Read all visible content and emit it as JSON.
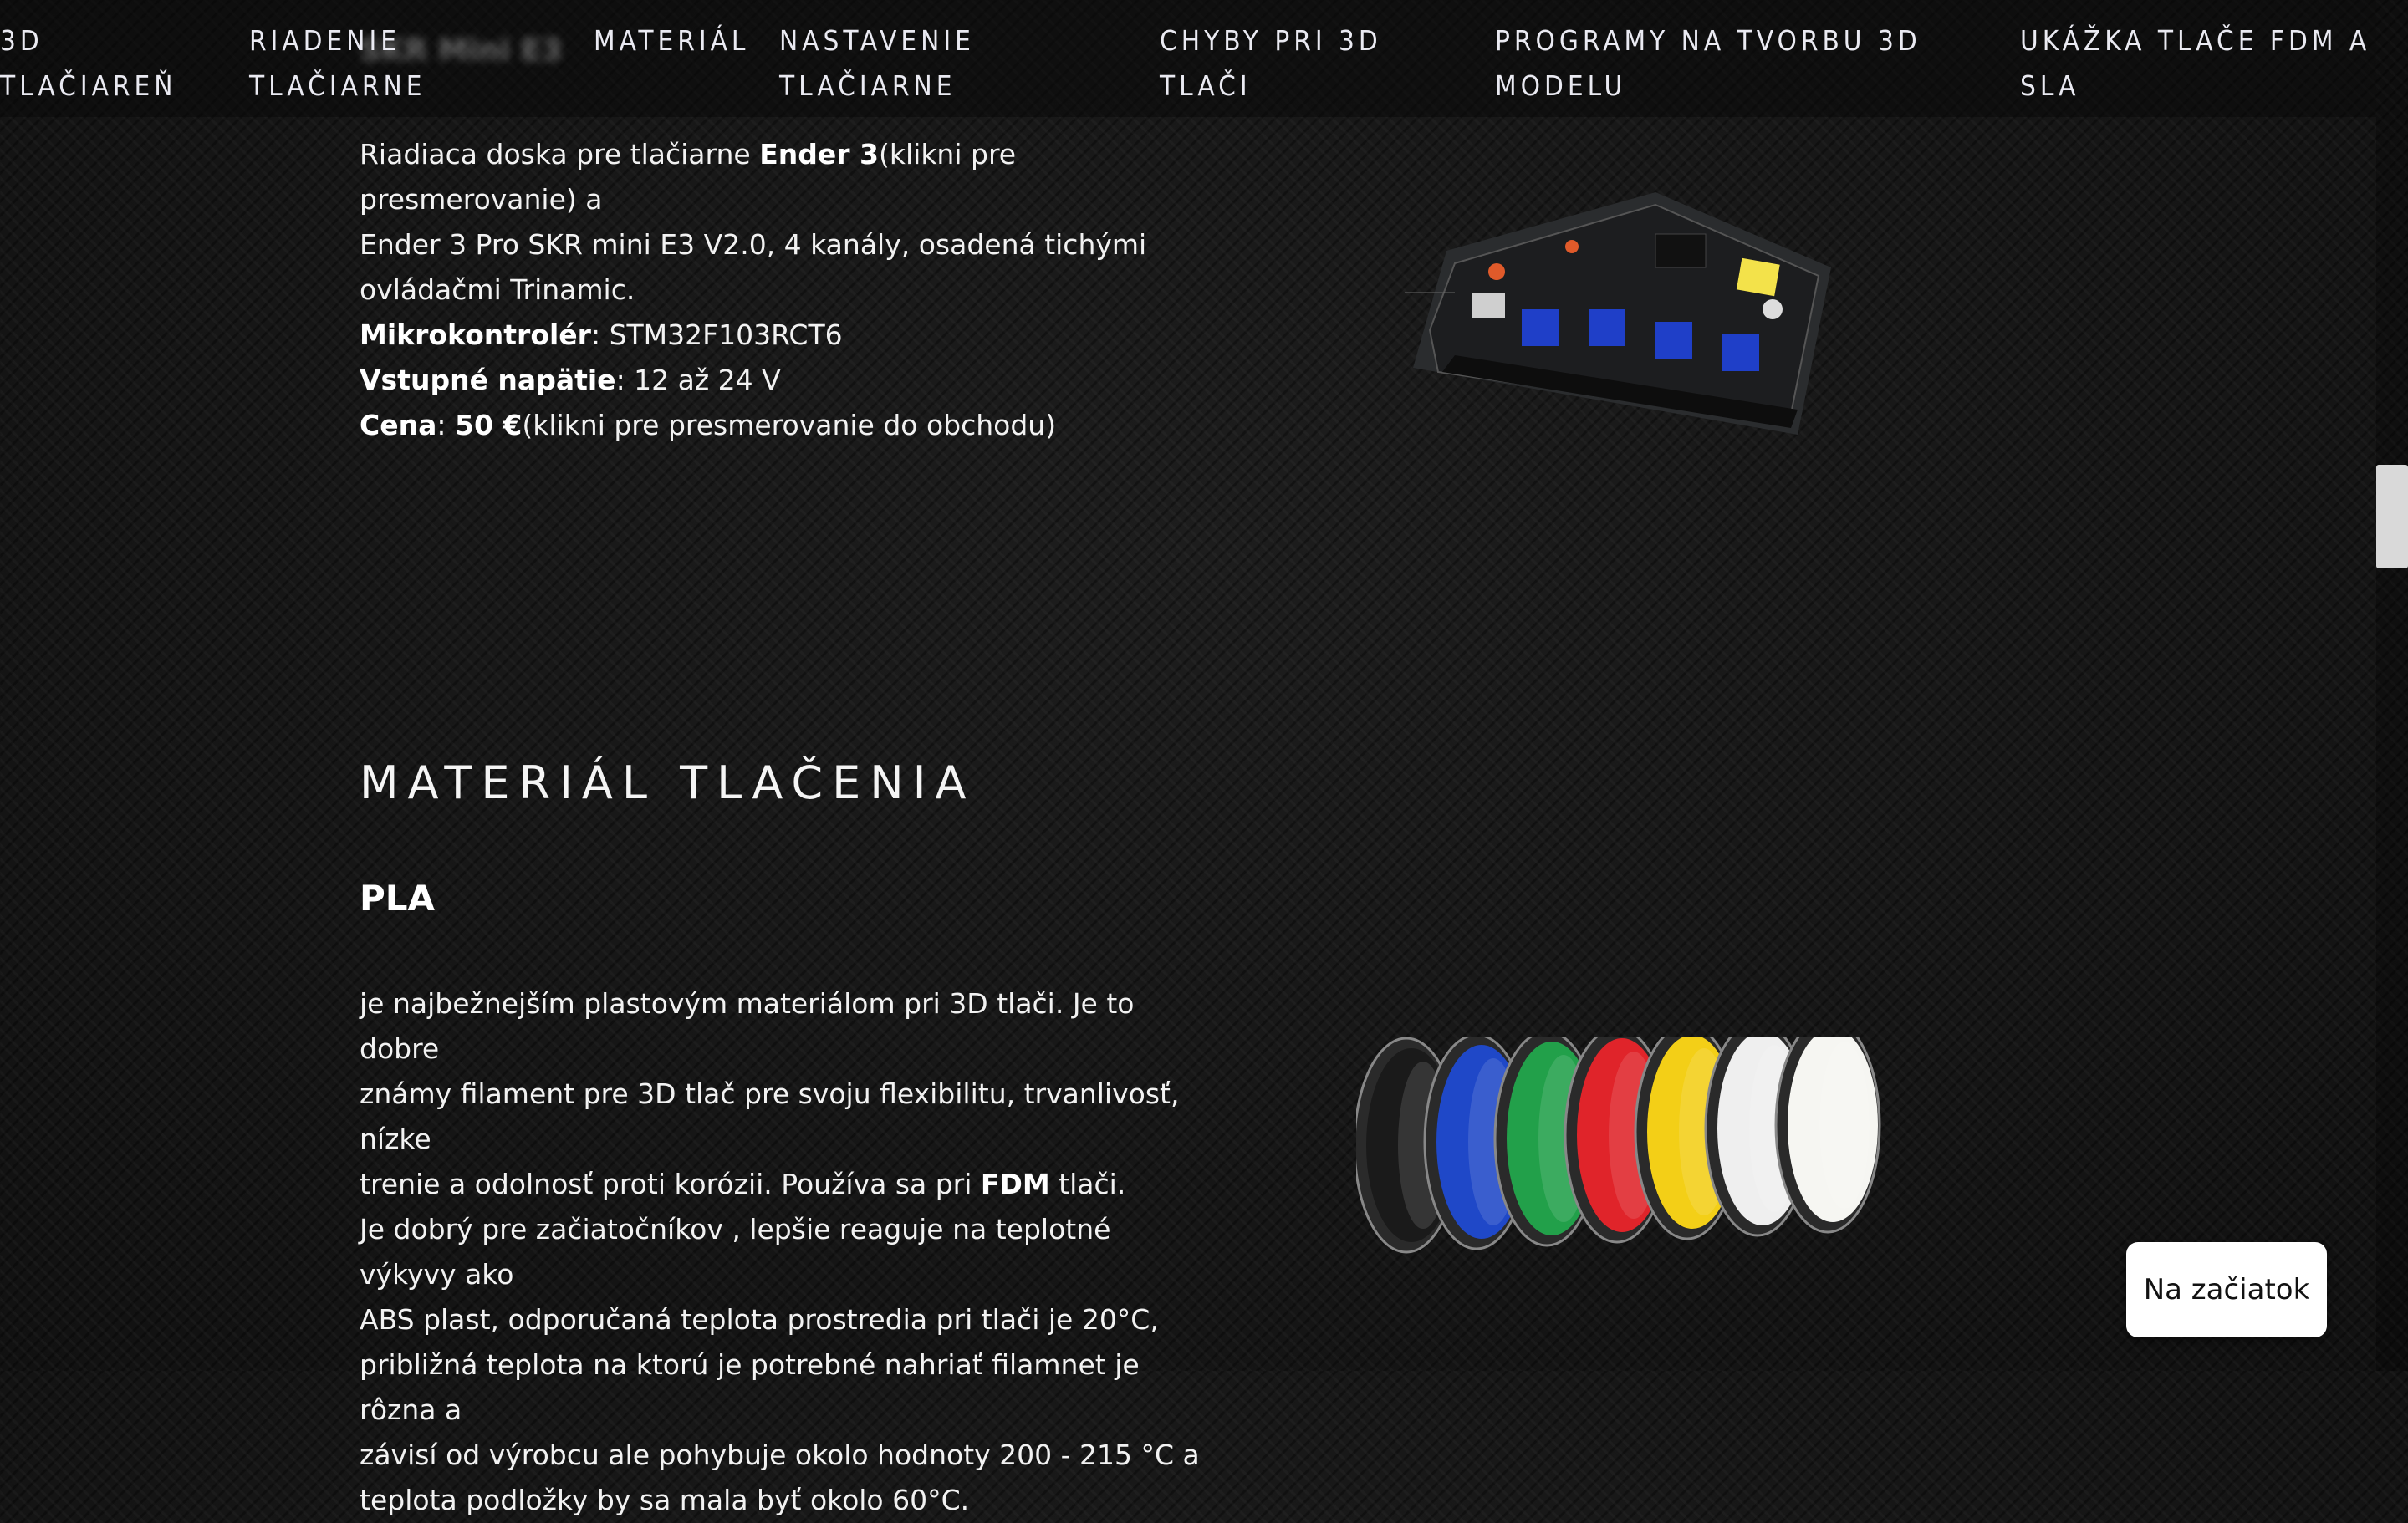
{
  "nav": {
    "items": [
      {
        "label": "3D\nTLAČIAREŇ"
      },
      {
        "label": "RIADENIE\nTLAČIARNE"
      },
      {
        "label": "MATERIÁL"
      },
      {
        "label": "NASTAVENIE\nTLAČIARNE"
      },
      {
        "label": "CHYBY PRI 3D\nTLAČI"
      },
      {
        "label": "PROGRAMY NA TVORBU 3D\nMODELU"
      },
      {
        "label": "UKÁŽKA TLAČE FDM A\nSLA"
      }
    ],
    "ghost_title": "SKR Mini E3"
  },
  "board": {
    "intro_a": "Riadiaca doska pre tlačiarne ",
    "intro_bold": "Ender 3",
    "intro_b": "(klikni pre presmerovanie) a",
    "line2": "Ender 3 Pro SKR mini E3 V2.0, 4 kanály, osadená tichými",
    "line3": "ovládačmi Trinamic.",
    "mcu_label": "Mikrokontrolér",
    "mcu_value": ": STM32F103RCT6",
    "voltage_label": "Vstupné napätie",
    "voltage_value": ": 12 až 24 V",
    "price_label": "Cena",
    "price_sep": ": ",
    "price_value": "50 €",
    "price_note": "(klikni pre presmerovanie do obchodu)"
  },
  "material": {
    "section_title": "MATERIÁL TLAČENIA",
    "pla_title": "PLA",
    "pla_p1a": "je najbežnejším plastovým materiálom pri 3D tlači. Je to dobre",
    "pla_p1b": "známy filament pre 3D tlač pre svoju flexibilitu, trvanlivosť, nízke",
    "pla_p1c": "trenie a odolnosť proti korózii. Používa sa pri ",
    "pla_p1_bold": "FDM",
    "pla_p1d": " tlači.",
    "pla_p2a": "Je dobrý pre začiatočníkov , lepšie reaguje na teplotné výkyvy ako",
    "pla_p2b": "ABS plast, odporučaná teplota prostredia pri tlači je 20°C,",
    "pla_p2c": "približná teplota na ktorú je potrebné nahriať filamnet je rôzna a",
    "pla_p2d": "závisí od výrobcu ale pohybuje okolo hodnoty 200 - 215 °C a",
    "pla_p2e": "teplota podložky by sa mala byť okolo 60°C.",
    "spool_colors": [
      "#1a1a1a",
      "#1f48c8",
      "#22a04a",
      "#e0242a",
      "#f3cf17",
      "#efefef",
      "#f6f6f2"
    ]
  },
  "back_button": {
    "label": "Na začiatok"
  }
}
